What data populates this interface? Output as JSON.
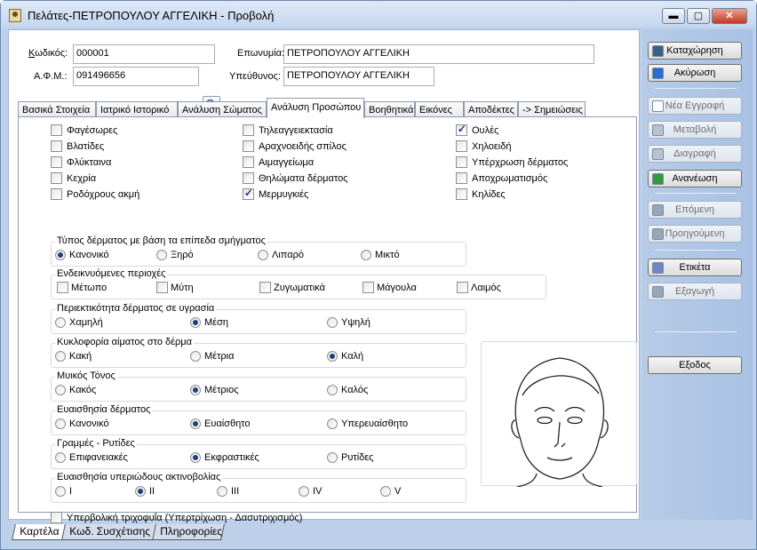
{
  "window": {
    "title": "Πελάτες-ΠΕΤΡΟΠΟΥΛΟΥ ΑΓΓΕΛΙΚΗ -  Προβολή",
    "min": "▬",
    "max": "▢",
    "close": "✕"
  },
  "header": {
    "code_label": "Κωδικός:",
    "code_value": "000001",
    "afm_label": "Α.Φ.Μ.:",
    "afm_value": "091496656",
    "name_label": "Επωνυμία:",
    "name_value": "ΠΕΤΡΟΠΟΥΛΟΥ ΑΓΓΕΛΙΚΗ",
    "resp_label": "Υπεύθυνος:",
    "resp_value": "ΠΕΤΡΟΠΟΥΛΟΥ ΑΓΓΕΛΙΚΗ",
    "search_icon": "magnifier-icon"
  },
  "tabs": [
    "Βασικά Στοιχεία",
    "Ιατρικό Ιστορικό",
    "Ανάλυση Σώματος",
    "Ανάλυση Προσώπου",
    "Βοηθητικά",
    "Εικόνες",
    "Αποδέκτες",
    "-> Σημειώσεις"
  ],
  "selected_tab": "Ανάλυση Προσώπου",
  "checks": [
    {
      "label": "Φαγέσωρες",
      "checked": false
    },
    {
      "label": "Βλατίδες",
      "checked": false
    },
    {
      "label": "Φλύκταινα",
      "checked": false
    },
    {
      "label": "Κεχρία",
      "checked": false
    },
    {
      "label": "Ροδόχρους ακμή",
      "checked": false
    },
    {
      "label": "Τηλεαγγειεκτασία",
      "checked": false
    },
    {
      "label": "Αραχνοειδής σπίλος",
      "checked": false
    },
    {
      "label": "Αιμαγγείωμα",
      "checked": false
    },
    {
      "label": "Θηλώματα δέρματος",
      "checked": false
    },
    {
      "label": "Μερμυγκιές",
      "checked": true
    },
    {
      "label": "Ουλές",
      "checked": true
    },
    {
      "label": "Χηλοειδή",
      "checked": false
    },
    {
      "label": "Υπέρχρωση δέρματος",
      "checked": false
    },
    {
      "label": "Αποχρωματισμός",
      "checked": false
    },
    {
      "label": "Κηλίδες",
      "checked": false
    }
  ],
  "groups": [
    {
      "title": "Τύπος δέρματος με βάση τα επίπεδα σμήγματος",
      "options": [
        "Κανονικό",
        "Ξηρό",
        "Λιπαρό",
        "Μικτό"
      ],
      "selected": 0
    },
    {
      "title": "Ενδεικνυόμενες περιοχές",
      "checkboxes": [
        "Μέτωπο",
        "Μύτη",
        "Ζυγωματικά",
        "Μάγουλα",
        "Λαιμός"
      ]
    },
    {
      "title": "Περιεκτικότητα δέρματος σε υγρασία",
      "options": [
        "Χαμηλή",
        "Μέση",
        "Υψηλή"
      ],
      "selected": 1
    },
    {
      "title": "Κυκλοφορία αίματος στο δέρμα",
      "options": [
        "Κακή",
        "Μέτρια",
        "Καλή"
      ],
      "selected": 2
    },
    {
      "title": "Μυικός Τόνος",
      "options": [
        "Κακός",
        "Μέτριος",
        "Καλός"
      ],
      "selected": 1
    },
    {
      "title": "Ευαισθησία δέρματος",
      "options": [
        "Κανονικό",
        "Ευαίσθητο",
        "Υπερευαίσθητο"
      ],
      "selected": 1
    },
    {
      "title": "Γραμμές - Ρυτίδες",
      "options": [
        "Επιφανειακές",
        "Εκφραστικές",
        "Ρυτίδες"
      ],
      "selected": 1
    },
    {
      "title": "Ευαισθησία υπεριώδους ακτινοβολίας",
      "options": [
        "I",
        "II",
        "III",
        "IV",
        "V"
      ],
      "selected": 1
    }
  ],
  "hair_check": {
    "label": "Υπερβολική τριχοφυΐα (Υπερτρίχωση - Δασυτριχισμός)",
    "checked": false
  },
  "sidebar": [
    {
      "label": "Καταχώρηση",
      "icon": "save-icon",
      "enabled": true
    },
    {
      "label": "Ακύρωση",
      "icon": "undo-icon",
      "enabled": true
    },
    {
      "label": "Νέα Εγγραφή",
      "icon": "new-doc-icon",
      "enabled": false
    },
    {
      "label": "Μεταβολή",
      "icon": "edit-icon",
      "enabled": false
    },
    {
      "label": "Διαγραφή",
      "icon": "delete-icon",
      "enabled": false
    },
    {
      "label": "Ανανέωση",
      "icon": "refresh-icon",
      "enabled": true
    },
    {
      "label": "Επόμενη",
      "icon": "arrow-right-icon",
      "enabled": false
    },
    {
      "label": "Προηγούμενη",
      "icon": "arrow-left-icon",
      "enabled": false
    },
    {
      "label": "Ετικέτα",
      "icon": "tag-icon",
      "enabled": true
    },
    {
      "label": "Εξαγωγή",
      "icon": "export-icon",
      "enabled": false
    },
    {
      "label": "Εξοδος",
      "icon": "",
      "enabled": true
    }
  ],
  "bottom_tabs": [
    "Καρτέλα",
    "Κωδ. Συσχέτισης",
    "Πληροφορίες"
  ]
}
